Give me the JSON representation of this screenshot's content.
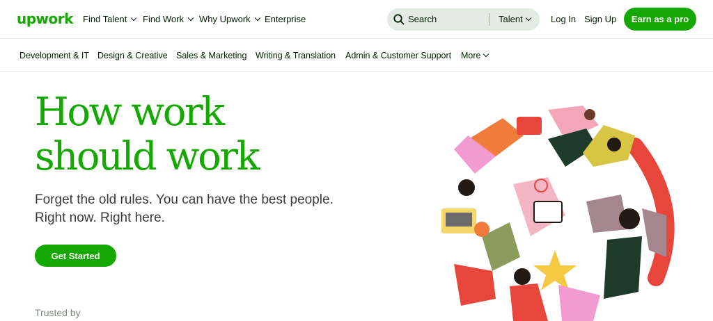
{
  "header": {
    "logo": "upwork",
    "nav": [
      {
        "label": "Find Talent"
      },
      {
        "label": "Find Work"
      },
      {
        "label": "Why Upwork"
      },
      {
        "label": "Enterprise"
      }
    ],
    "search": {
      "placeholder": "Search",
      "scope": "Talent"
    },
    "login": "Log In",
    "signup": "Sign Up",
    "cta": "Earn as a pro"
  },
  "categories": [
    "Development & IT",
    "Design & Creative",
    "Sales & Marketing",
    "Writing & Translation",
    "Admin & Customer Support",
    "More"
  ],
  "hero": {
    "headline_1": "How work",
    "headline_2": "should work",
    "sub_1": "Forget the old rules. You can have the best people.",
    "sub_2": "Right now. Right here.",
    "cta": "Get Started",
    "trusted": "Trusted by"
  },
  "colors": {
    "brand": "#14a800",
    "text": "#001e00",
    "search_bg": "#e4ebe4"
  }
}
